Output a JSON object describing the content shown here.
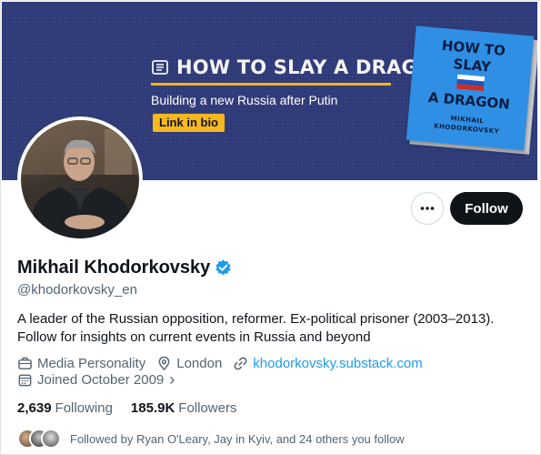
{
  "banner": {
    "title": "HOW TO SLAY A DRAGON",
    "subtitle": "Building a new Russia after Putin",
    "cta": "Link in bio",
    "book": {
      "line1": "HOW TO",
      "line2": "SLAY",
      "line3": "A DRAGON",
      "author1": "MIKHAIL",
      "author2": "KHODORKOVSKY"
    },
    "colors": {
      "background": "#2f3b78",
      "accent": "#f4b31d",
      "book": "#2e8fe4"
    }
  },
  "actions": {
    "more_icon": "more-horizontal-icon",
    "follow_label": "Follow"
  },
  "profile": {
    "name": "Mikhail Khodorkovsky",
    "handle": "@khodorkovsky_en",
    "verified": true,
    "bio_line1": "A leader of the Russian opposition, reformer. Ex-political prisoner (2003–2013).",
    "bio_line2": "Follow for insights on current events in Russia and beyond",
    "category": "Media Personality",
    "location": "London",
    "website": "khodorkovsky.substack.com",
    "joined": "Joined October 2009",
    "joined_chevron": "›"
  },
  "stats": {
    "following_count": "2,639",
    "following_label": "Following",
    "followers_count": "185.9K",
    "followers_label": "Followers"
  },
  "followed_by": {
    "text": "Followed by Ryan O'Leary, Jay in Kyiv, and 24 others you follow"
  },
  "colors": {
    "text_primary": "#0f1419",
    "text_secondary": "#536471",
    "link": "#1d9bf0",
    "verified": "#1d9bf0",
    "follow_button": "#0f1419"
  }
}
